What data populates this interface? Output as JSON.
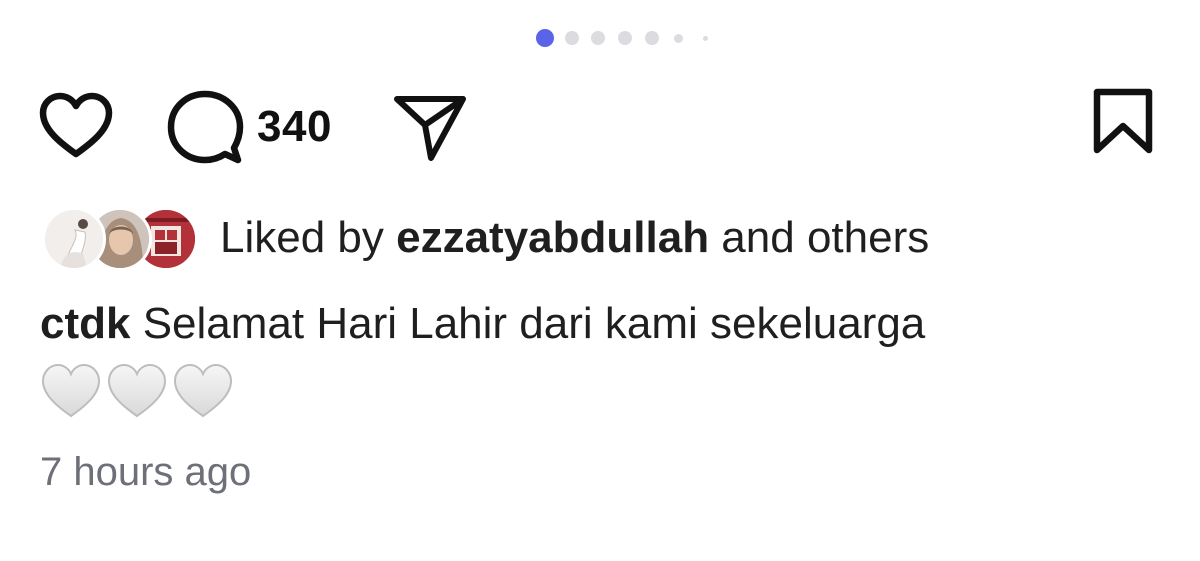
{
  "carousel": {
    "dot_count": 7,
    "active_index": 0,
    "active_color": "#5b63e8",
    "inactive_color": "#dbdbe0"
  },
  "actions": {
    "like_icon": "heart-outline-icon",
    "comment_icon": "comment-bubble-icon",
    "comment_count": "340",
    "share_icon": "paper-plane-icon",
    "save_icon": "bookmark-outline-icon"
  },
  "likes": {
    "prefix": "Liked by ",
    "username": "ezzatyabdullah",
    "suffix": " and others"
  },
  "caption": {
    "username": "ctdk",
    "text": " Selamat Hari Lahir dari kami sekeluarga",
    "emoji": "🤍🤍🤍"
  },
  "timestamp": "7 hours ago"
}
